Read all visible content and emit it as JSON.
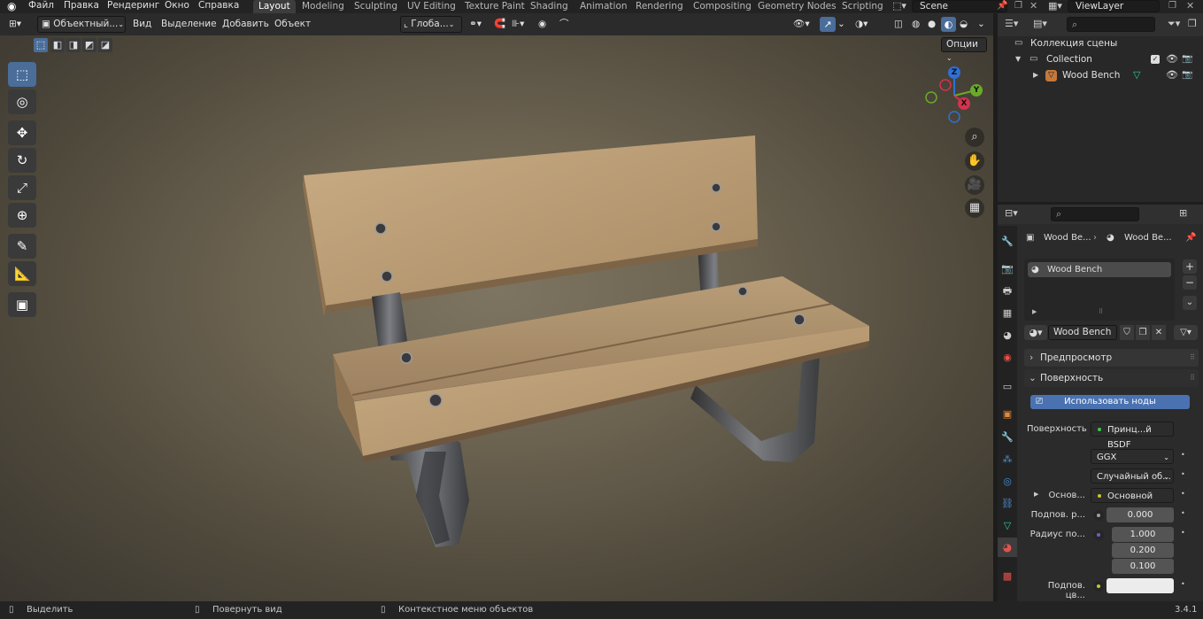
{
  "top_menu": {
    "logo_icon": "blender-logo-icon",
    "items": [
      "Файл",
      "Правка",
      "Рендеринг",
      "Окно",
      "Справка"
    ]
  },
  "workspaces": {
    "active": "Layout",
    "tabs": [
      "Layout",
      "Modeling",
      "Sculpting",
      "UV Editing",
      "Texture Paint",
      "Shading",
      "Animation",
      "Rendering",
      "Compositing",
      "Geometry Nodes",
      "Scripting"
    ]
  },
  "scene": {
    "label": "Scene",
    "view_layer": "ViewLayer"
  },
  "viewport_header": {
    "mode": "Объектный...",
    "menus": [
      "Вид",
      "Выделение",
      "Добавить",
      "Объект"
    ],
    "orientation": "Глоба...",
    "options": "Опции"
  },
  "toolbar": {
    "tools": [
      "select-box-icon",
      "cursor-icon",
      "move-icon",
      "rotate-icon",
      "scale-icon",
      "transform-icon",
      "annotate-icon",
      "measure-icon",
      "add-cube-icon"
    ]
  },
  "gizmo": {
    "x": "X",
    "y": "Y",
    "z": "Z"
  },
  "outliner": {
    "root": "Коллекция сцены",
    "collection": "Collection",
    "object": "Wood Bench"
  },
  "properties": {
    "breadcrumb_object": "Wood Be...",
    "breadcrumb_material": "Wood Be...",
    "material_slot": "Wood Bench",
    "material_name": "Wood Bench",
    "panels": {
      "preview": "Предпросмотр",
      "surface": "Поверхность"
    },
    "use_nodes_button": "Использовать ноды",
    "surface_label": "Поверхность",
    "surface_value": "Принц...й BSDF",
    "distribution": "GGX",
    "subsurface_method": "Случайный об...",
    "base_label": "Основ...",
    "base_value": "Основной цвет",
    "subsurface_label": "Подпов. р...",
    "subsurface_value": "0.000",
    "radius_label": "Радиус по...",
    "radius_values": [
      "1.000",
      "0.200",
      "0.100"
    ],
    "subsurface_color_label": "Подпов. цв..."
  },
  "status_bar": {
    "select": "Выделить",
    "rotate": "Повернуть вид",
    "context": "Контекстное меню объектов",
    "version": "3.4.1"
  }
}
